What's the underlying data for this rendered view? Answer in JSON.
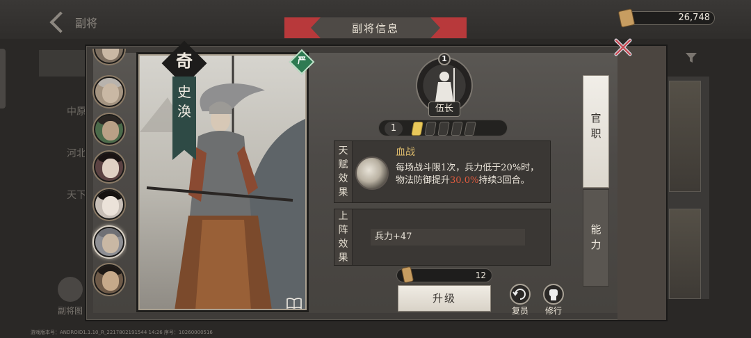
{
  "header": {
    "back_label": "副将",
    "currency_value": "26,748"
  },
  "background": {
    "menu_items": [
      "",
      "中原",
      "河北",
      "天下"
    ],
    "card_list_label": "副将图"
  },
  "modal": {
    "title": "副将信息"
  },
  "card": {
    "type_label": "奇",
    "name": "史涣",
    "rank_label": "严"
  },
  "soldier": {
    "badge_number": "1",
    "rank_title": "伍长"
  },
  "stars": {
    "level": "1",
    "filled": 1,
    "total": 5
  },
  "talent": {
    "label_chars": [
      "天",
      "赋",
      "效",
      "果"
    ],
    "name": "血战",
    "desc_part1": "每场战斗限1次，兵力低于20%时，物法防御提升",
    "desc_highlight": "30.0%",
    "desc_part2": "持续3回合。"
  },
  "deploy": {
    "label_chars": [
      "上",
      "阵",
      "效",
      "果"
    ],
    "stat": "兵力+47"
  },
  "material": {
    "count": "12"
  },
  "actions": {
    "upgrade_label": "升级",
    "restore_label": "复员",
    "cultivate_label": "修行"
  },
  "tabs": {
    "official_chars": [
      "官",
      "职"
    ],
    "ability_chars": [
      "能",
      "力"
    ]
  },
  "footer": {
    "build_info": "游戏版本号：ANDROID1.1.10_R_2217802191544 14:26 序号：10260000516"
  },
  "colors": {
    "title_banner": "#b8393b",
    "talent_name": "#d9b86b",
    "highlight": "#e05b3e",
    "star_on": "#e9c85a",
    "rank_badge": "#2e7a52"
  }
}
